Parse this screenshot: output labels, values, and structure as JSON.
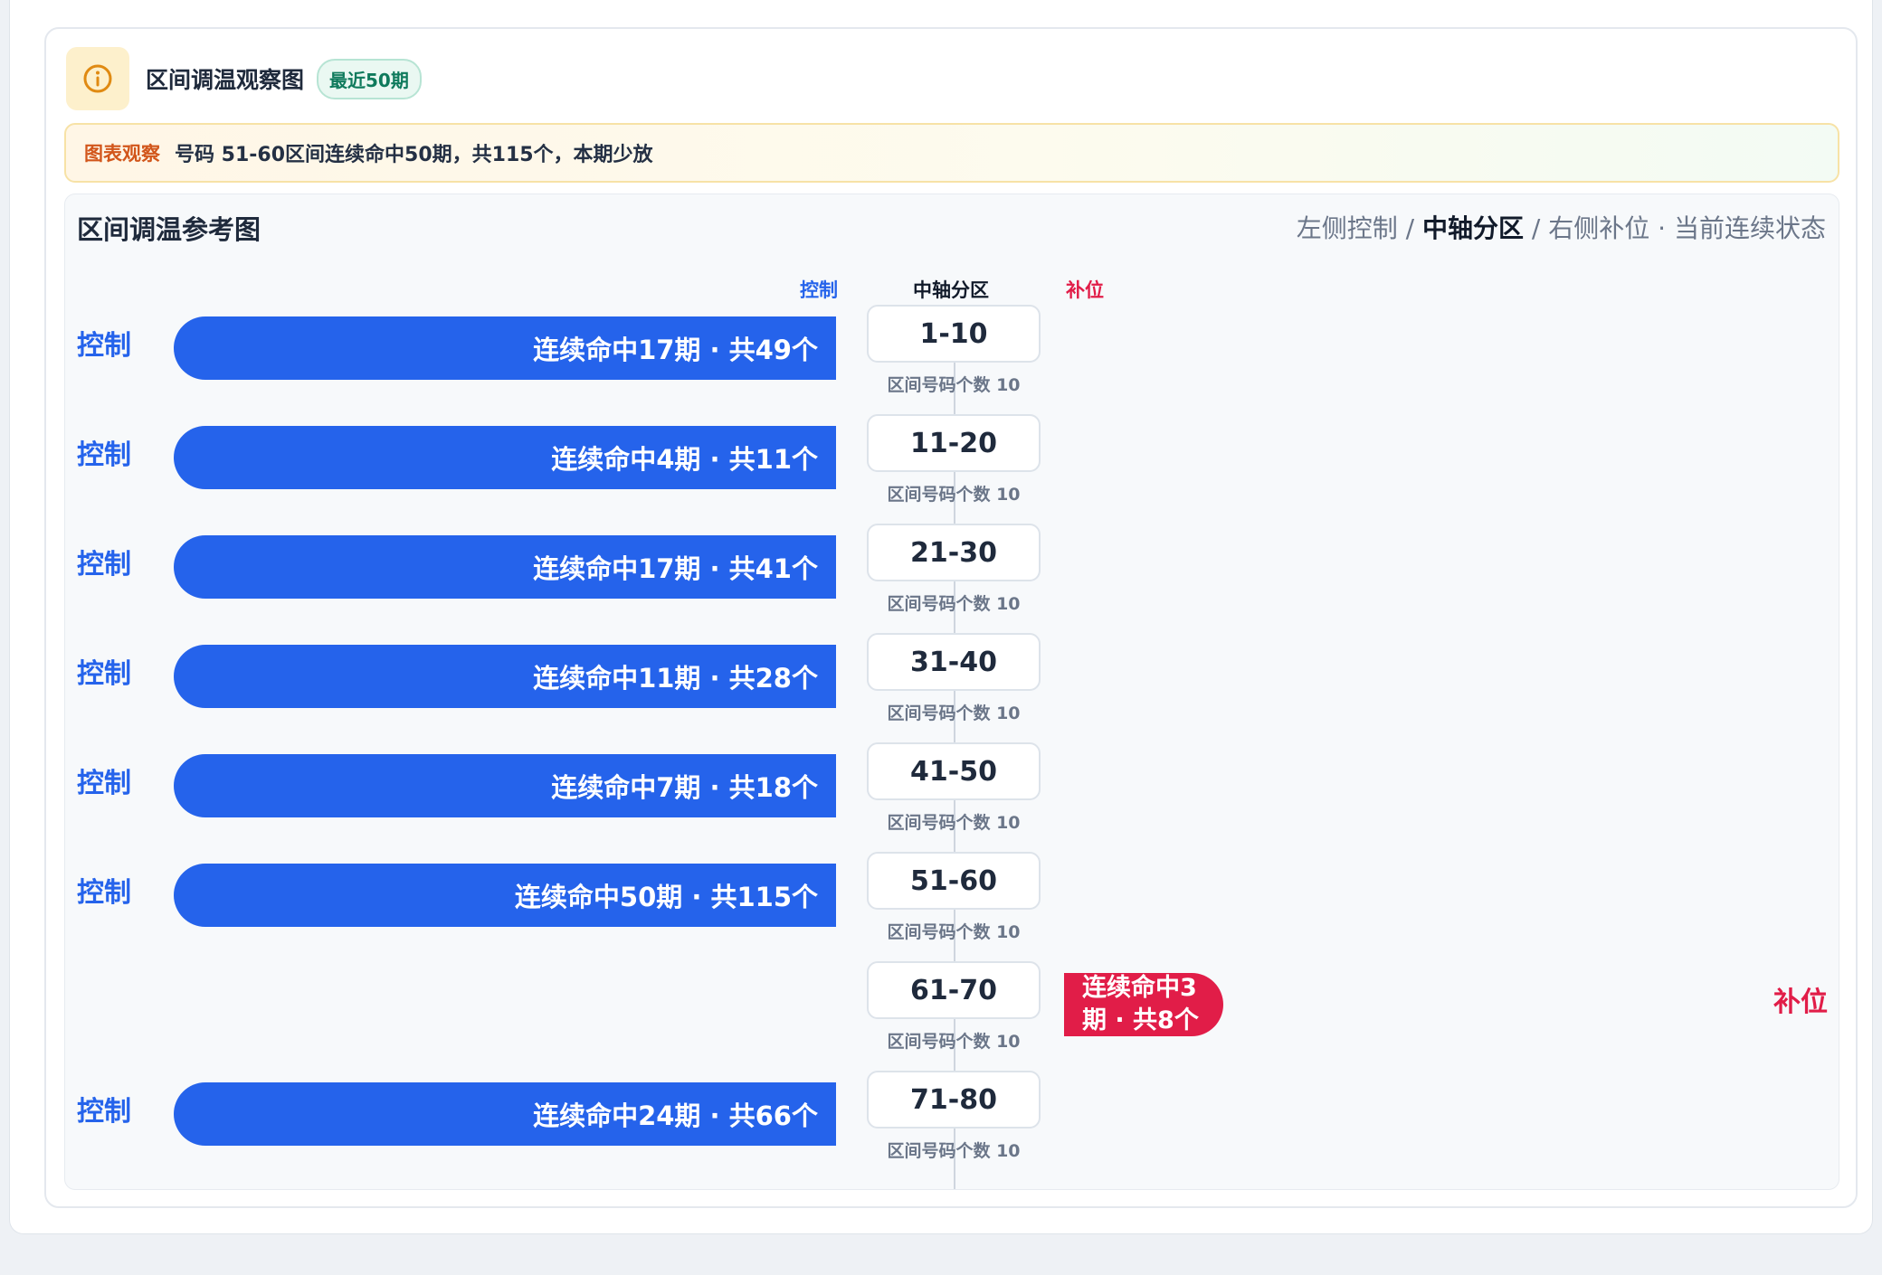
{
  "header": {
    "title": "区间调温观察图",
    "badge": "最近50期"
  },
  "observation": {
    "label": "图表观察",
    "text": "号码 51-60区间连续命中50期，共115个，本期少放"
  },
  "panel": {
    "title": "区间调温参考图",
    "legend": {
      "left": "左侧控制",
      "sep1": " / ",
      "center": "中轴分区",
      "sep2": " / ",
      "right": "右侧补位",
      "dot": " · ",
      "state": "当前连续状态"
    },
    "columns": {
      "left": "控制",
      "center": "中轴分区",
      "right": "补位"
    }
  },
  "colors": {
    "control": "#2563eb",
    "fill": "#e11d48",
    "badge": "#0f7a5c"
  },
  "rows": [
    {
      "side_label": "控制",
      "bar_text": "连续命中17期 · 共49个",
      "zone": "1-10",
      "count_text": "区间号码个数 10"
    },
    {
      "side_label": "控制",
      "bar_text": "连续命中4期 · 共11个",
      "zone": "11-20",
      "count_text": "区间号码个数 10"
    },
    {
      "side_label": "控制",
      "bar_text": "连续命中17期 · 共41个",
      "zone": "21-30",
      "count_text": "区间号码个数 10"
    },
    {
      "side_label": "控制",
      "bar_text": "连续命中11期 · 共28个",
      "zone": "31-40",
      "count_text": "区间号码个数 10"
    },
    {
      "side_label": "控制",
      "bar_text": "连续命中7期 · 共18个",
      "zone": "41-50",
      "count_text": "区间号码个数 10"
    },
    {
      "side_label": "控制",
      "bar_text": "连续命中50期 · 共115个",
      "zone": "51-60",
      "count_text": "区间号码个数 10"
    },
    {
      "zone": "61-70",
      "count_text": "区间号码个数 10",
      "right_bar_text": "连续命中3期 · 共8个",
      "right_label": "补位"
    },
    {
      "side_label": "控制",
      "bar_text": "连续命中24期 · 共66个",
      "zone": "71-80",
      "count_text": "区间号码个数 10"
    }
  ]
}
